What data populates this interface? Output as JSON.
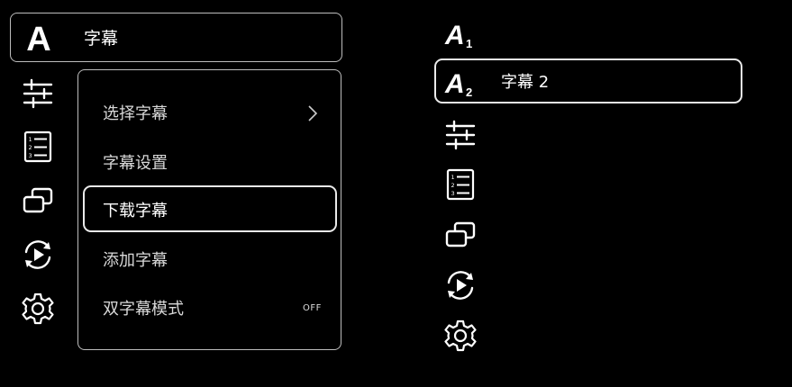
{
  "left_panel": {
    "header_label": "字幕",
    "menu_items": [
      {
        "label": "选择字幕",
        "has_submenu": true
      },
      {
        "label": "字幕设置"
      },
      {
        "label": "下载字幕",
        "selected": true
      },
      {
        "label": "添加字幕"
      },
      {
        "label": "双字幕模式",
        "value": "OFF"
      }
    ],
    "icons": [
      "subtitle-a-icon",
      "sliders-icon",
      "numbered-list-icon",
      "picture-in-picture-icon",
      "replay-icon",
      "gear-icon"
    ]
  },
  "right_panel": {
    "selected_item_label": "字幕 2",
    "icons": [
      "subtitle-a1-icon",
      "subtitle-a2-icon",
      "sliders-icon",
      "numbered-list-icon",
      "picture-in-picture-icon",
      "replay-icon",
      "gear-icon"
    ]
  },
  "colors": {
    "background": "#000000",
    "text": "#ffffff",
    "muted_text": "#d8d8d8",
    "border": "#bdbdbd"
  }
}
